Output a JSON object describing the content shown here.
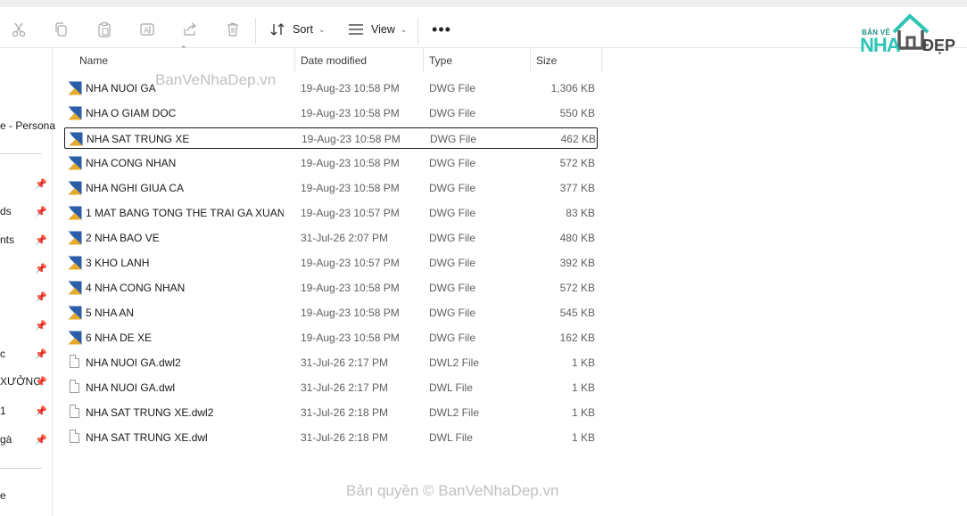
{
  "toolbar": {
    "sort_label": "Sort",
    "view_label": "View",
    "icons": [
      "cut-icon",
      "copy-icon",
      "paste-icon",
      "rename-icon",
      "share-icon",
      "delete-icon"
    ]
  },
  "logo": {
    "small": "BẢN VẼ",
    "big": "NHA",
    "suffix": "ĐẸP"
  },
  "sidebar": {
    "items": [
      {
        "label": "e - Persona"
      },
      {
        "label": ""
      },
      {
        "label": "ds"
      },
      {
        "label": "nts"
      },
      {
        "label": ""
      },
      {
        "label": ""
      },
      {
        "label": ""
      },
      {
        "label": "c"
      },
      {
        "label": "XƯỞNG"
      },
      {
        "label": "1"
      },
      {
        "label": "gà"
      },
      {
        "label": "e"
      }
    ]
  },
  "columns": {
    "name": "Name",
    "date": "Date modified",
    "type": "Type",
    "size": "Size"
  },
  "files": [
    {
      "name": "NHA NUOI GA",
      "date": "19-Aug-23 10:58 PM",
      "type": "DWG File",
      "size": "1,306 KB",
      "kind": "dwg"
    },
    {
      "name": "NHA O GIAM DOC",
      "date": "19-Aug-23 10:58 PM",
      "type": "DWG File",
      "size": "550 KB",
      "kind": "dwg"
    },
    {
      "name": "NHA SAT TRUNG XE",
      "date": "19-Aug-23 10:58 PM",
      "type": "DWG File",
      "size": "462 KB",
      "kind": "dwg",
      "selected": true
    },
    {
      "name": "NHA CONG NHAN",
      "date": "19-Aug-23 10:58 PM",
      "type": "DWG File",
      "size": "572 KB",
      "kind": "dwg"
    },
    {
      "name": "NHA NGHI GIUA CA",
      "date": "19-Aug-23 10:58 PM",
      "type": "DWG File",
      "size": "377 KB",
      "kind": "dwg"
    },
    {
      "name": "1 MAT BANG TONG THE TRAI GA XUAN ...",
      "date": "19-Aug-23 10:57 PM",
      "type": "DWG File",
      "size": "83 KB",
      "kind": "dwg"
    },
    {
      "name": "2 NHA BAO VE",
      "date": "31-Jul-26 2:07 PM",
      "type": "DWG File",
      "size": "480 KB",
      "kind": "dwg"
    },
    {
      "name": "3 KHO LANH",
      "date": "19-Aug-23 10:57 PM",
      "type": "DWG File",
      "size": "392 KB",
      "kind": "dwg"
    },
    {
      "name": "4 NHA CONG NHAN",
      "date": "19-Aug-23 10:58 PM",
      "type": "DWG File",
      "size": "572 KB",
      "kind": "dwg"
    },
    {
      "name": "5 NHA AN",
      "date": "19-Aug-23 10:58 PM",
      "type": "DWG File",
      "size": "545 KB",
      "kind": "dwg"
    },
    {
      "name": "6 NHA DE XE",
      "date": "19-Aug-23 10:58 PM",
      "type": "DWG File",
      "size": "162 KB",
      "kind": "dwg"
    },
    {
      "name": "NHA NUOI GA.dwl2",
      "date": "31-Jul-26 2:17 PM",
      "type": "DWL2 File",
      "size": "1 KB",
      "kind": "doc"
    },
    {
      "name": "NHA NUOI GA.dwl",
      "date": "31-Jul-26 2:17 PM",
      "type": "DWL File",
      "size": "1 KB",
      "kind": "doc"
    },
    {
      "name": "NHA SAT TRUNG XE.dwl2",
      "date": "31-Jul-26 2:18 PM",
      "type": "DWL2 File",
      "size": "1 KB",
      "kind": "doc"
    },
    {
      "name": "NHA SAT TRUNG XE.dwl",
      "date": "31-Jul-26 2:18 PM",
      "type": "DWL File",
      "size": "1 KB",
      "kind": "doc"
    }
  ],
  "watermarks": {
    "top": "BanVeNhaDep.vn",
    "bottom": "Bản quyền © BanVeNhaDep.vn"
  }
}
